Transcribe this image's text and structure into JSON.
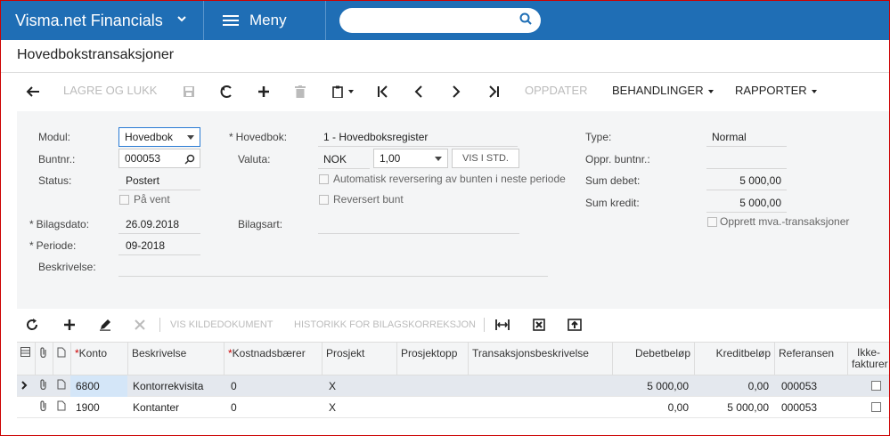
{
  "app": {
    "brand": "Visma.net Financials",
    "menu_label": "Meny",
    "search_placeholder": ""
  },
  "page": {
    "title": "Hovedbokstransaksjoner"
  },
  "toolbar": {
    "save_close": "LAGRE OG LUKK",
    "update": "OPPDATER",
    "actions": "BEHANDLINGER",
    "reports": "RAPPORTER"
  },
  "form": {
    "module_label": "Modul:",
    "module_value": "Hovedbok",
    "batch_label": "Buntnr.:",
    "batch_value": "000053",
    "status_label": "Status:",
    "status_value": "Postert",
    "hold_label": "På vent",
    "docdate_label": "Bilagsdato:",
    "docdate_value": "26.09.2018",
    "period_label": "Periode:",
    "period_value": "09-2018",
    "desc_label": "Beskrivelse:",
    "desc_value": "",
    "ledger_label": "Hovedbok:",
    "ledger_value": "1 - Hovedboksregister",
    "currency_label": "Valuta:",
    "currency_value": "NOK",
    "rate_value": "1,00",
    "vis_std": "VIS I STD.",
    "auto_reverse_label": "Automatisk reversering av bunten i neste periode",
    "reversed_label": "Reversert bunt",
    "doctype_label": "Bilagsart:",
    "doctype_value": "",
    "type_label": "Type:",
    "type_value": "Normal",
    "orig_batch_label": "Oppr. buntnr.:",
    "orig_batch_value": "",
    "sum_debit_label": "Sum debet:",
    "sum_debit_value": "5 000,00",
    "sum_credit_label": "Sum kredit:",
    "sum_credit_value": "5 000,00",
    "create_vat_label": "Opprett mva.-transaksjoner"
  },
  "grid_toolbar": {
    "view_source": "VIS KILDEDOKUMENT",
    "history": "HISTORIKK FOR BILAGSKORREKSJON"
  },
  "grid": {
    "headers": {
      "konto": "Konto",
      "beskrivelse": "Beskrivelse",
      "kostnadsbaerer": "Kostnadsbærer",
      "prosjekt": "Prosjekt",
      "prosjektoppg": "Prosjektopp",
      "transaksjonsbeskrivelse": "Transaksjonsbeskrivelse",
      "debet": "Debetbeløp",
      "kredit": "Kreditbeløp",
      "referansen": "Referansen",
      "ikke_fakturer_1": "Ikke-",
      "ikke_fakturer_2": "fakturer"
    },
    "rows": [
      {
        "konto": "6800",
        "beskrivelse": "Kontorrekvisita",
        "kostnadsbaerer": "0",
        "prosjekt": "X",
        "prosjektoppg": "",
        "transaksjonsbeskrivelse": "",
        "debet": "5 000,00",
        "kredit": "0,00",
        "referansen": "000053"
      },
      {
        "konto": "1900",
        "beskrivelse": "Kontanter",
        "kostnadsbaerer": "0",
        "prosjekt": "X",
        "prosjektoppg": "",
        "transaksjonsbeskrivelse": "",
        "debet": "0,00",
        "kredit": "5 000,00",
        "referansen": "000053"
      }
    ]
  }
}
